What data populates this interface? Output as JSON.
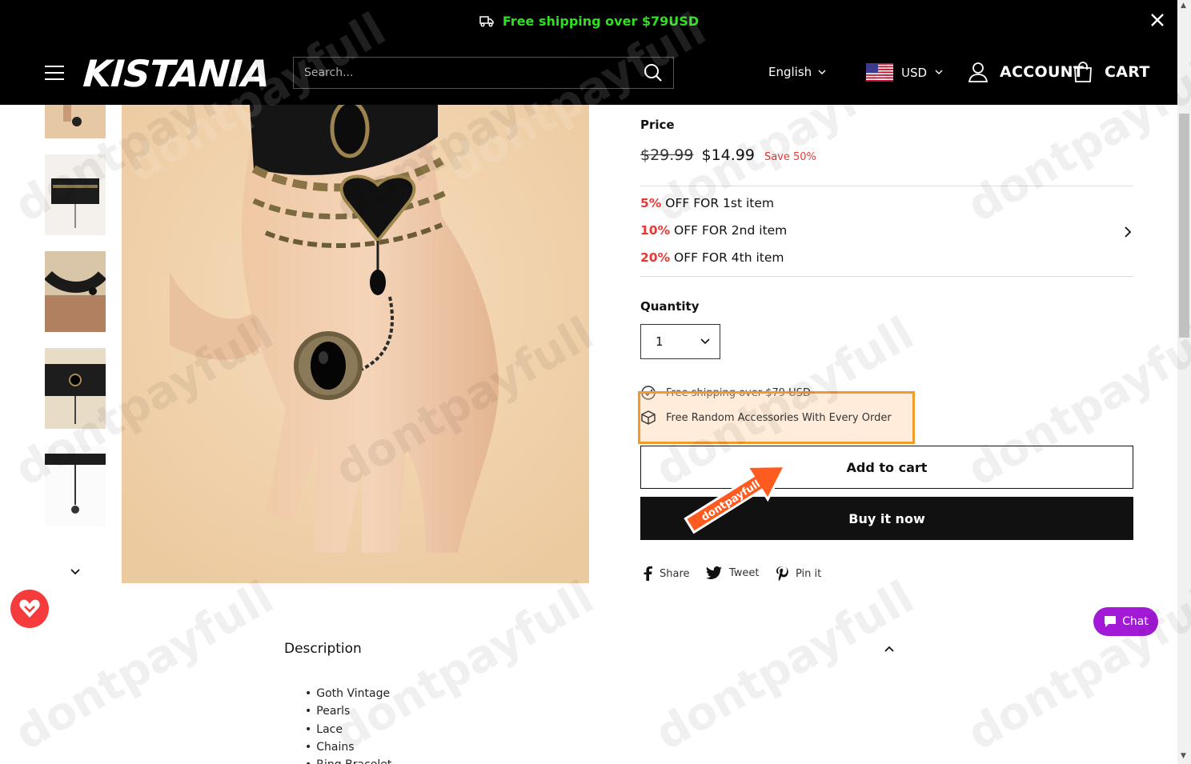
{
  "announcement": {
    "text": "Free shipping over $79USD"
  },
  "header": {
    "logo": "KISTANIA",
    "search_placeholder": "Search...",
    "language": "English",
    "currency": "USD",
    "account_label": "ACCOUNT",
    "cart_label": "CART"
  },
  "product": {
    "price_label": "Price",
    "price_old": "$29.99",
    "price_new": "$14.99",
    "save_label": "Save 50%",
    "discounts": [
      {
        "pct": "5%",
        "text": " OFF FOR 1st item"
      },
      {
        "pct": "10%",
        "text": " OFF FOR 2nd item"
      },
      {
        "pct": "20%",
        "text": " OFF FOR 4th item"
      }
    ],
    "quantity_label": "Quantity",
    "quantity_value": "1",
    "perks": [
      "Free shipping over $79 USD",
      "Free Random Accessories With Every Order"
    ],
    "add_to_cart": "Add to cart",
    "buy_now": "Buy it now",
    "share": {
      "facebook": "Share",
      "twitter": "Tweet",
      "pinterest": "Pin it"
    }
  },
  "promo_arrow_text": "dontpayfull",
  "description": {
    "title": "Description",
    "items": [
      "Goth Vintage",
      "Pearls",
      "Lace",
      "Chains",
      "Ring Bracelet"
    ]
  },
  "chat": {
    "label": "Chat"
  },
  "watermark": "dontpayfull",
  "colors": {
    "announce_green": "#2ee01f",
    "sale_red": "#e53935",
    "highlight_orange": "#f29a2e",
    "chat_purple": "#a31ad6"
  }
}
